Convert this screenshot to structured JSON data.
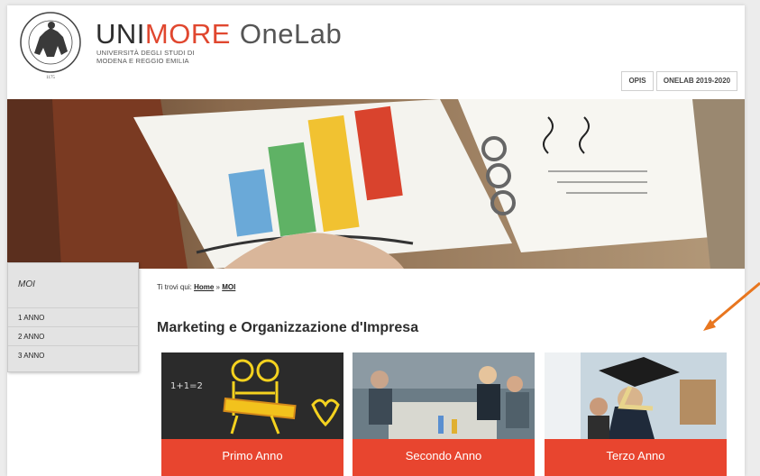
{
  "header": {
    "brand_part1": "UNI",
    "brand_part2": "MORE",
    "brand_part3": "OneLab",
    "subtitle_line1": "UNIVERSITÀ DEGLI STUDI DI",
    "subtitle_line2": "MODENA E REGGIO EMILIA",
    "seal_text": "1175",
    "buttons": [
      {
        "label": "OPIS"
      },
      {
        "label": "ONELAB 2019-2020"
      }
    ]
  },
  "sidebar": {
    "title": "MOI",
    "items": [
      {
        "label": "1 ANNO"
      },
      {
        "label": "2 ANNO"
      },
      {
        "label": "3 ANNO"
      }
    ]
  },
  "breadcrumb": {
    "prefix": "Ti trovi qui:",
    "home": "Home",
    "separator": "»",
    "current": "MOI"
  },
  "main": {
    "title": "Marketing e Organizzazione d'Impresa",
    "cards": [
      {
        "label": "Primo Anno"
      },
      {
        "label": "Secondo Anno"
      },
      {
        "label": "Terzo Anno"
      }
    ]
  },
  "colors": {
    "accent": "#e8452f",
    "annotation_arrow": "#e8761f"
  }
}
